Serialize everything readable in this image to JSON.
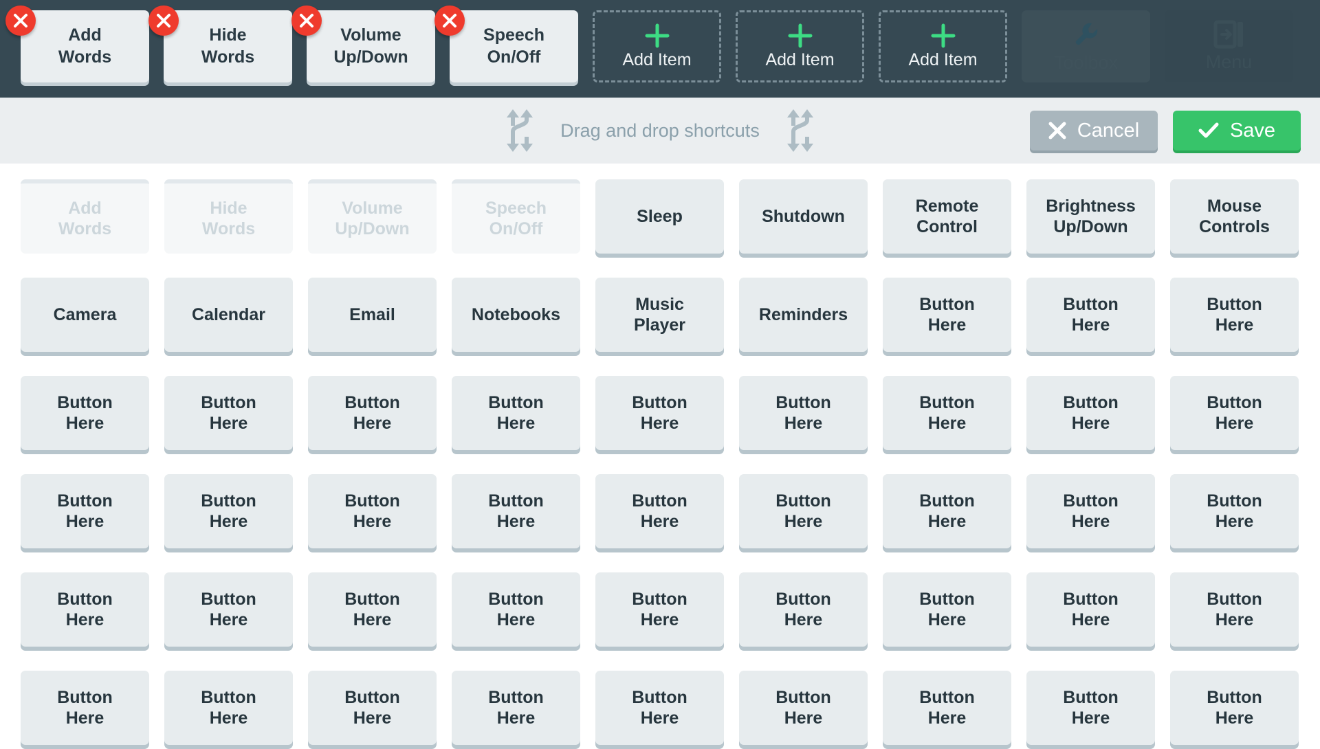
{
  "topbar": {
    "shortcuts": [
      {
        "label": "Add\nWords",
        "remove_icon": "close-icon"
      },
      {
        "label": "Hide\nWords",
        "remove_icon": "close-icon"
      },
      {
        "label": "Volume\nUp/Down",
        "remove_icon": "close-icon"
      },
      {
        "label": "Speech\nOn/Off",
        "remove_icon": "close-icon"
      }
    ],
    "empty_slots": [
      {
        "label": "Add Item",
        "icon": "plus-icon"
      },
      {
        "label": "Add Item",
        "icon": "plus-icon"
      },
      {
        "label": "Add Item",
        "icon": "plus-icon"
      }
    ],
    "fixed_items": [
      {
        "label": "Toolbox",
        "icon": "wrench-icon",
        "state": "disabled"
      },
      {
        "label": "Menu",
        "icon": "menu-panel-icon",
        "state": "disabled"
      }
    ]
  },
  "actionbar": {
    "hint_text": "Drag and drop shortcuts",
    "hint_icon_left": "swap-vertical-icon",
    "hint_icon_right": "swap-vertical-icon",
    "cancel": {
      "label": "Cancel",
      "icon": "close-icon"
    },
    "save": {
      "label": "Save",
      "icon": "check-icon"
    }
  },
  "grid": {
    "columns": 9,
    "cells": [
      {
        "label": "Add\nWords",
        "state": "disabled"
      },
      {
        "label": "Hide\nWords",
        "state": "disabled"
      },
      {
        "label": "Volume\nUp/Down",
        "state": "disabled"
      },
      {
        "label": "Speech\nOn/Off",
        "state": "disabled"
      },
      {
        "label": "Sleep",
        "state": "enabled"
      },
      {
        "label": "Shutdown",
        "state": "enabled"
      },
      {
        "label": "Remote\nControl",
        "state": "enabled"
      },
      {
        "label": "Brightness\nUp/Down",
        "state": "enabled"
      },
      {
        "label": "Mouse\nControls",
        "state": "enabled"
      },
      {
        "label": "Camera",
        "state": "enabled"
      },
      {
        "label": "Calendar",
        "state": "enabled"
      },
      {
        "label": "Email",
        "state": "enabled"
      },
      {
        "label": "Notebooks",
        "state": "enabled"
      },
      {
        "label": "Music\nPlayer",
        "state": "enabled"
      },
      {
        "label": "Reminders",
        "state": "enabled"
      },
      {
        "label": "Button\nHere",
        "state": "enabled"
      },
      {
        "label": "Button\nHere",
        "state": "enabled"
      },
      {
        "label": "Button\nHere",
        "state": "enabled"
      },
      {
        "label": "Button\nHere",
        "state": "enabled"
      },
      {
        "label": "Button\nHere",
        "state": "enabled"
      },
      {
        "label": "Button\nHere",
        "state": "enabled"
      },
      {
        "label": "Button\nHere",
        "state": "enabled"
      },
      {
        "label": "Button\nHere",
        "state": "enabled"
      },
      {
        "label": "Button\nHere",
        "state": "enabled"
      },
      {
        "label": "Button\nHere",
        "state": "enabled"
      },
      {
        "label": "Button\nHere",
        "state": "enabled"
      },
      {
        "label": "Button\nHere",
        "state": "enabled"
      },
      {
        "label": "Button\nHere",
        "state": "enabled"
      },
      {
        "label": "Button\nHere",
        "state": "enabled"
      },
      {
        "label": "Button\nHere",
        "state": "enabled"
      },
      {
        "label": "Button\nHere",
        "state": "enabled"
      },
      {
        "label": "Button\nHere",
        "state": "enabled"
      },
      {
        "label": "Button\nHere",
        "state": "enabled"
      },
      {
        "label": "Button\nHere",
        "state": "enabled"
      },
      {
        "label": "Button\nHere",
        "state": "enabled"
      },
      {
        "label": "Button\nHere",
        "state": "enabled"
      },
      {
        "label": "Button\nHere",
        "state": "enabled"
      },
      {
        "label": "Button\nHere",
        "state": "enabled"
      },
      {
        "label": "Button\nHere",
        "state": "enabled"
      },
      {
        "label": "Button\nHere",
        "state": "enabled"
      },
      {
        "label": "Button\nHere",
        "state": "enabled"
      },
      {
        "label": "Button\nHere",
        "state": "enabled"
      },
      {
        "label": "Button\nHere",
        "state": "enabled"
      },
      {
        "label": "Button\nHere",
        "state": "enabled"
      },
      {
        "label": "Button\nHere",
        "state": "enabled"
      },
      {
        "label": "Button\nHere",
        "state": "enabled"
      },
      {
        "label": "Button\nHere",
        "state": "enabled"
      },
      {
        "label": "Button\nHere",
        "state": "enabled"
      },
      {
        "label": "Button\nHere",
        "state": "enabled"
      },
      {
        "label": "Button\nHere",
        "state": "enabled"
      },
      {
        "label": "Button\nHere",
        "state": "enabled"
      },
      {
        "label": "Button\nHere",
        "state": "enabled"
      },
      {
        "label": "Button\nHere",
        "state": "enabled"
      },
      {
        "label": "Button\nHere",
        "state": "enabled"
      }
    ]
  },
  "colors": {
    "topbar_bg": "#364953",
    "actionbar_bg": "#ebeef0",
    "card_bg": "#e7ecee",
    "card_shadow": "#b7c5cc",
    "remove_badge": "#ef3b2d",
    "accent_green": "#37c46a",
    "plus_green": "#3ddc84",
    "cancel_gray": "#a9b6bd",
    "hint_text": "#8ba0ab",
    "disabled_text": "#ccd6db"
  }
}
